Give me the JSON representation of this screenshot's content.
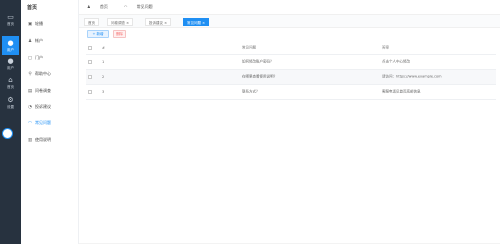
{
  "rail": {
    "items": [
      {
        "label": "首页",
        "icon": "home-icon"
      },
      {
        "label": "用户",
        "icon": "user-icon"
      },
      {
        "label": "用户",
        "icon": "user-icon"
      },
      {
        "label": "首页",
        "icon": "home-icon"
      },
      {
        "label": "设置",
        "icon": "gear-icon"
      }
    ],
    "active_index": 1,
    "accent": "#1f8ff3",
    "background": "#27323f"
  },
  "menu": {
    "title": "首页",
    "items": [
      {
        "label": "轮播",
        "icon": "dashboard-icon"
      },
      {
        "label": "帐户",
        "icon": "user-icon"
      },
      {
        "label": "门户",
        "icon": "lock-icon"
      },
      {
        "label": "帮助中心",
        "icon": "link-icon"
      },
      {
        "label": "问卷调查",
        "icon": "chat-icon"
      },
      {
        "label": "投诉建议",
        "icon": "edit-icon"
      },
      {
        "label": "常见问题",
        "icon": "help-icon"
      },
      {
        "label": "使用说明",
        "icon": "book-icon"
      }
    ],
    "active_index": 6
  },
  "header": {
    "user": "首页",
    "breadcrumb": "常见问题"
  },
  "tabs": [
    {
      "label": "首页"
    },
    {
      "label": "问卷调查 ×"
    },
    {
      "label": "投诉建议 ×"
    },
    {
      "label": "常见问题 ×"
    }
  ],
  "toolbar": {
    "add_label": "+ 新增",
    "delete_label": "删除"
  },
  "table": {
    "headers": {
      "num": "#",
      "question": "常见问题",
      "answer": "答案"
    },
    "rows": [
      {
        "num": "1",
        "question": "如何修改账户密码？",
        "answer": "点击个人中心修改"
      },
      {
        "num": "2",
        "question": "在哪里查看使用说明？",
        "answer": "请访问：https://www.example.com"
      },
      {
        "num": "3",
        "question": "联系方式？",
        "answer": "客服电话见首页底部信息"
      }
    ]
  }
}
